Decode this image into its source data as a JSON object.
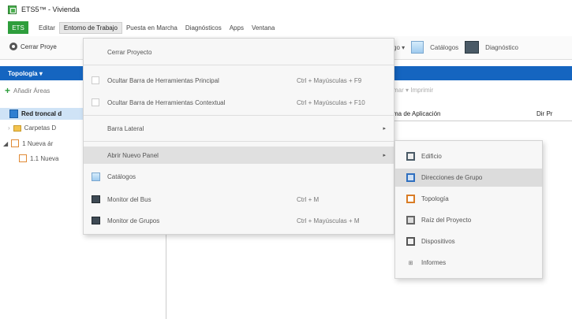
{
  "window": {
    "title": "ETS5™ - Vivienda"
  },
  "menubar": {
    "ets_label": "ETS",
    "items": [
      "Editar",
      "Entorno de Trabajo",
      "Puesta en Marcha",
      "Diagnósticos",
      "Apps",
      "Ventana"
    ]
  },
  "toolbar": {
    "close_project": "Cerrar Proye",
    "search_partial": "go ▾",
    "catalogs": "Catálogos",
    "diagnostics": "Diagnóstico"
  },
  "left_panel": {
    "header": "Topología ▾",
    "add_areas": "Añadir Áreas",
    "selected_row": "Red troncal d",
    "tree": [
      "Carpetas D",
      "1 Nueva ár",
      "1.1 Nueva"
    ]
  },
  "right_bg": {
    "imprimir": "mar ▾   Imprimir",
    "col_app": "ma de Aplicación",
    "col_dir": "Dir Pr"
  },
  "dropdown": {
    "items": [
      {
        "label": "Cerrar Proyecto",
        "shortcut": ""
      },
      {
        "label": "Ocultar Barra de Herramientas Principal",
        "shortcut": "Ctrl + Mayúsculas + F9"
      },
      {
        "label": "Ocultar Barra de Herramientas Contextual",
        "shortcut": "Ctrl + Mayúsculas + F10"
      },
      {
        "label": "Barra Lateral",
        "shortcut": ""
      },
      {
        "label": "Abrir Nuevo Panel",
        "shortcut": ""
      },
      {
        "label": "Catálogos",
        "shortcut": ""
      },
      {
        "label": "Monitor del Bus",
        "shortcut": "Ctrl + M"
      },
      {
        "label": "Monitor de Grupos",
        "shortcut": "Ctrl + Mayúsculas + M"
      }
    ]
  },
  "submenu": {
    "items": [
      "Edificio",
      "Direcciones de Grupo",
      "Topología",
      "Raíz del Proyecto",
      "Dispositivos",
      "Informes"
    ]
  }
}
